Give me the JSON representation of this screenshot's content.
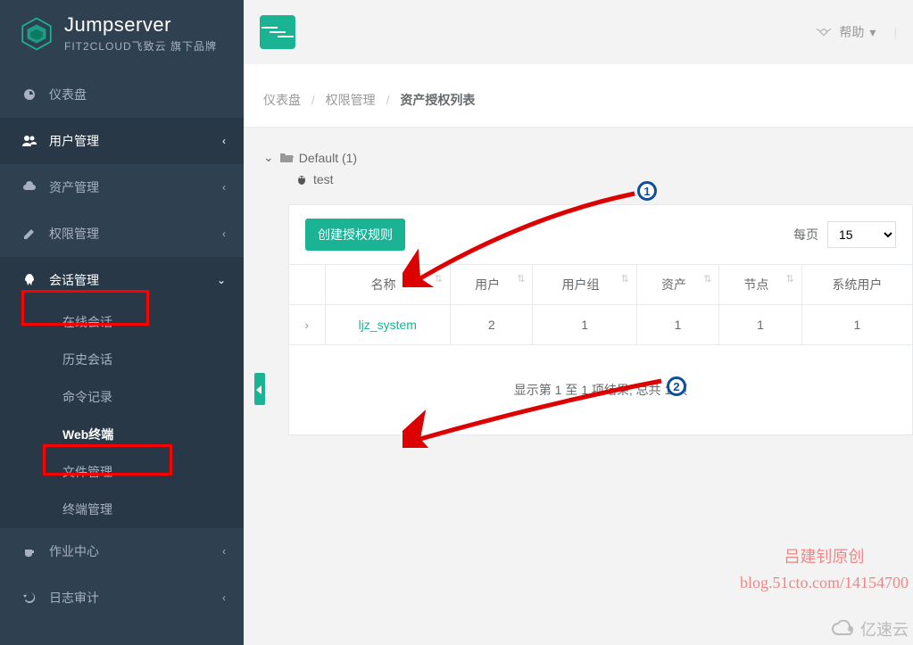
{
  "brand": {
    "name": "Jumpserver",
    "sub": "FIT2CLOUD飞致云 旗下品牌"
  },
  "sidebar": {
    "items": [
      {
        "label": "仪表盘"
      },
      {
        "label": "用户管理"
      },
      {
        "label": "资产管理"
      },
      {
        "label": "权限管理"
      },
      {
        "label": "会话管理"
      },
      {
        "label": "作业中心"
      },
      {
        "label": "日志审计"
      }
    ],
    "session_sub": [
      {
        "label": "在线会话"
      },
      {
        "label": "历史会话"
      },
      {
        "label": "命令记录"
      },
      {
        "label": "Web终端"
      },
      {
        "label": "文件管理"
      },
      {
        "label": "终端管理"
      }
    ]
  },
  "topbar": {
    "help": "帮助"
  },
  "breadcrumb": {
    "a": "仪表盘",
    "b": "权限管理",
    "c": "资产授权列表"
  },
  "tree": {
    "root": "Default (1)",
    "child": "test"
  },
  "panel": {
    "create_btn": "创建授权规则",
    "page_label": "每页",
    "page_size": "15",
    "headers": [
      "",
      "名称",
      "用户",
      "用户组",
      "资产",
      "节点",
      "系统用户"
    ],
    "rows": [
      {
        "expand": "›",
        "name": "ljz_system",
        "user": "2",
        "group": "1",
        "asset": "1",
        "node": "1",
        "sysuser": "1"
      }
    ],
    "results": "显示第 1 至 1 项结果; 总共 1 项"
  },
  "badges": {
    "b1": "1",
    "b2": "2"
  },
  "watermark": {
    "l1": "吕建钊原创",
    "l2": "blog.51cto.com/14154700",
    "cloud": "亿速云"
  }
}
